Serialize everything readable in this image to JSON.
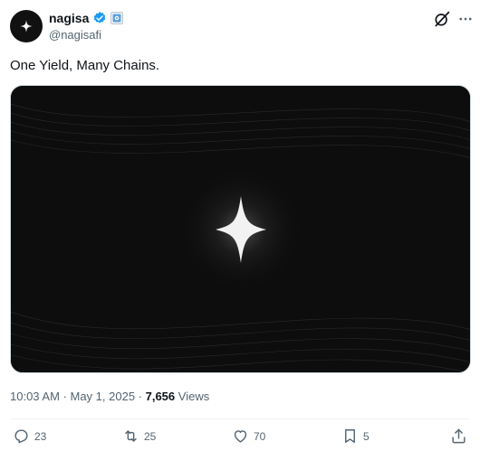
{
  "author": {
    "name": "nagisa",
    "handle": "@nagisafi",
    "avatar_icon": "sparkle-star-icon",
    "verified_color": "#1d9bf0"
  },
  "header_icons": [
    "grok-icon",
    "more-icon"
  ],
  "tweet": {
    "text": "One Yield, Many Chains.",
    "media_icon": "four-point-sparkle-icon"
  },
  "meta": {
    "time": "10:03 AM",
    "separator1": " · ",
    "date": "May 1, 2025",
    "separator2": " · ",
    "views_count": "7,656",
    "views_label": " Views"
  },
  "actions": {
    "replies": "23",
    "reposts": "25",
    "likes": "70",
    "bookmarks": "5"
  }
}
